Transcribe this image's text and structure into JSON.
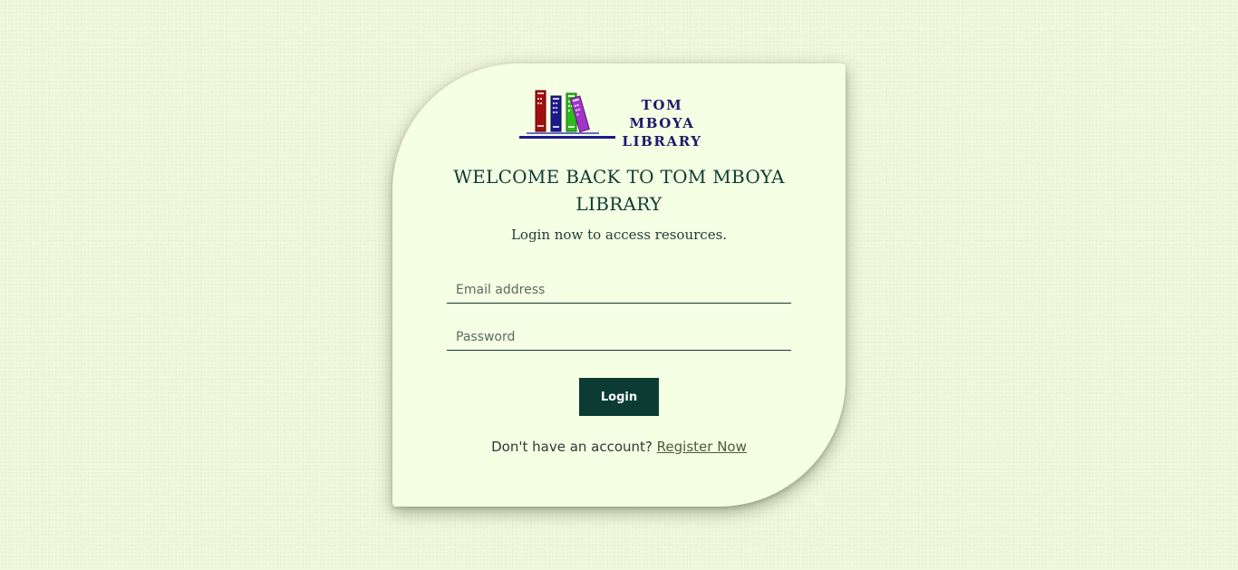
{
  "logo": {
    "line1": "TOM MBOYA",
    "line2": "LIBRARY",
    "text_color": "#1a1a6b",
    "book_colors": [
      "#a30f0f",
      "#1c1a8a",
      "#2dbb1f",
      "#a035c8"
    ]
  },
  "heading": {
    "title": "WELCOME BACK TO TOM MBOYA LIBRARY",
    "subtitle": "Login now to access resources."
  },
  "form": {
    "email_placeholder": "Email address",
    "email_value": "",
    "password_placeholder": "Password",
    "password_value": "",
    "login_label": "Login"
  },
  "footer": {
    "prompt": "Don't have an account?",
    "register_label": "Register Now"
  },
  "colors": {
    "background": "#f0f7dc",
    "card": "#f5ffe4",
    "accent": "#0c3b34"
  }
}
